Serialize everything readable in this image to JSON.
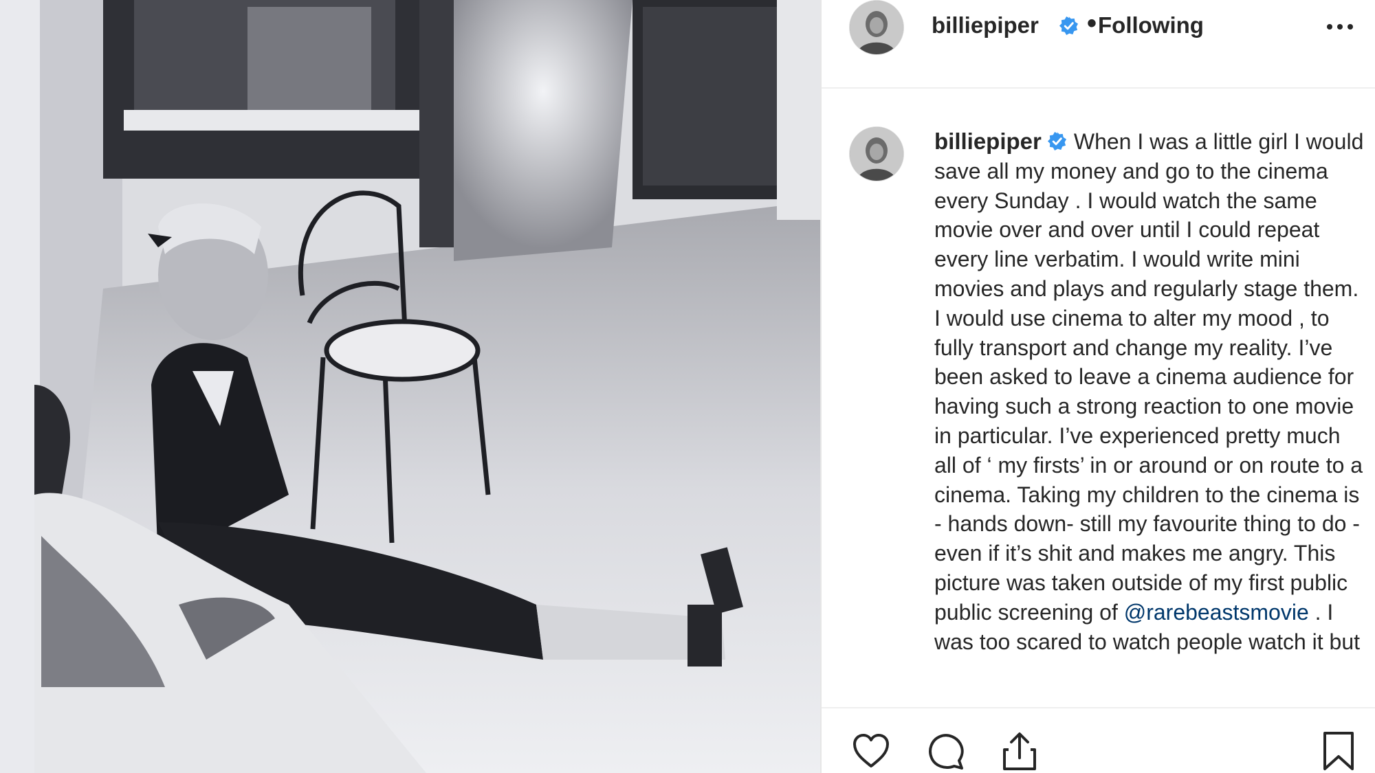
{
  "post": {
    "username": "billiepiper",
    "separator": "•",
    "follow_status": "Following",
    "caption_text": "When I was a little girl I would save all my money and go to the cinema every Sunday . I would watch the same movie over and over until I could repeat every line verbatim. I would write mini movies and plays and regularly stage them. I would use cinema to alter my mood , to fully transport and change my reality. I’ve been asked to leave a cinema audience for having such a strong reaction to one movie in particular. I’ve experienced pretty much all of ‘ my firsts’ in or around or on route to a cinema. Taking my children to the cinema is - hands down- still my favourite thing to do - even if it’s shit and makes me angry. This picture was taken outside of my first public public screening of",
    "mention": "@rarebeastsmovie",
    "caption_tail": " . I was too scared to watch people watch it but"
  },
  "icons": {
    "verified": "verified-badge-icon",
    "more": "more-options-icon",
    "like": "heart-icon",
    "comment": "comment-icon",
    "share": "share-icon",
    "save": "bookmark-icon"
  },
  "colors": {
    "verified_blue": "#3897f0",
    "mention": "#00376b",
    "text": "#262626"
  }
}
